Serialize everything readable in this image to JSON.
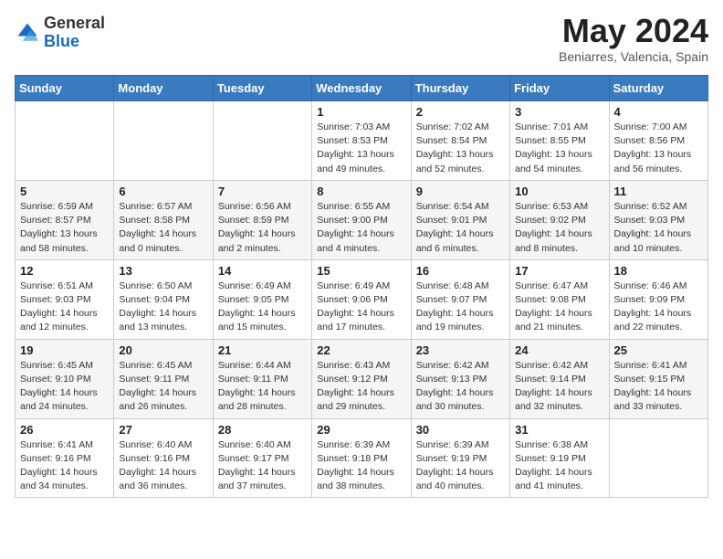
{
  "logo": {
    "general": "General",
    "blue": "Blue"
  },
  "header": {
    "month": "May 2024",
    "location": "Beniarres, Valencia, Spain"
  },
  "weekdays": [
    "Sunday",
    "Monday",
    "Tuesday",
    "Wednesday",
    "Thursday",
    "Friday",
    "Saturday"
  ],
  "weeks": [
    [
      {
        "day": "",
        "info": ""
      },
      {
        "day": "",
        "info": ""
      },
      {
        "day": "",
        "info": ""
      },
      {
        "day": "1",
        "info": "Sunrise: 7:03 AM\nSunset: 8:53 PM\nDaylight: 13 hours\nand 49 minutes."
      },
      {
        "day": "2",
        "info": "Sunrise: 7:02 AM\nSunset: 8:54 PM\nDaylight: 13 hours\nand 52 minutes."
      },
      {
        "day": "3",
        "info": "Sunrise: 7:01 AM\nSunset: 8:55 PM\nDaylight: 13 hours\nand 54 minutes."
      },
      {
        "day": "4",
        "info": "Sunrise: 7:00 AM\nSunset: 8:56 PM\nDaylight: 13 hours\nand 56 minutes."
      }
    ],
    [
      {
        "day": "5",
        "info": "Sunrise: 6:59 AM\nSunset: 8:57 PM\nDaylight: 13 hours\nand 58 minutes."
      },
      {
        "day": "6",
        "info": "Sunrise: 6:57 AM\nSunset: 8:58 PM\nDaylight: 14 hours\nand 0 minutes."
      },
      {
        "day": "7",
        "info": "Sunrise: 6:56 AM\nSunset: 8:59 PM\nDaylight: 14 hours\nand 2 minutes."
      },
      {
        "day": "8",
        "info": "Sunrise: 6:55 AM\nSunset: 9:00 PM\nDaylight: 14 hours\nand 4 minutes."
      },
      {
        "day": "9",
        "info": "Sunrise: 6:54 AM\nSunset: 9:01 PM\nDaylight: 14 hours\nand 6 minutes."
      },
      {
        "day": "10",
        "info": "Sunrise: 6:53 AM\nSunset: 9:02 PM\nDaylight: 14 hours\nand 8 minutes."
      },
      {
        "day": "11",
        "info": "Sunrise: 6:52 AM\nSunset: 9:03 PM\nDaylight: 14 hours\nand 10 minutes."
      }
    ],
    [
      {
        "day": "12",
        "info": "Sunrise: 6:51 AM\nSunset: 9:03 PM\nDaylight: 14 hours\nand 12 minutes."
      },
      {
        "day": "13",
        "info": "Sunrise: 6:50 AM\nSunset: 9:04 PM\nDaylight: 14 hours\nand 13 minutes."
      },
      {
        "day": "14",
        "info": "Sunrise: 6:49 AM\nSunset: 9:05 PM\nDaylight: 14 hours\nand 15 minutes."
      },
      {
        "day": "15",
        "info": "Sunrise: 6:49 AM\nSunset: 9:06 PM\nDaylight: 14 hours\nand 17 minutes."
      },
      {
        "day": "16",
        "info": "Sunrise: 6:48 AM\nSunset: 9:07 PM\nDaylight: 14 hours\nand 19 minutes."
      },
      {
        "day": "17",
        "info": "Sunrise: 6:47 AM\nSunset: 9:08 PM\nDaylight: 14 hours\nand 21 minutes."
      },
      {
        "day": "18",
        "info": "Sunrise: 6:46 AM\nSunset: 9:09 PM\nDaylight: 14 hours\nand 22 minutes."
      }
    ],
    [
      {
        "day": "19",
        "info": "Sunrise: 6:45 AM\nSunset: 9:10 PM\nDaylight: 14 hours\nand 24 minutes."
      },
      {
        "day": "20",
        "info": "Sunrise: 6:45 AM\nSunset: 9:11 PM\nDaylight: 14 hours\nand 26 minutes."
      },
      {
        "day": "21",
        "info": "Sunrise: 6:44 AM\nSunset: 9:11 PM\nDaylight: 14 hours\nand 28 minutes."
      },
      {
        "day": "22",
        "info": "Sunrise: 6:43 AM\nSunset: 9:12 PM\nDaylight: 14 hours\nand 29 minutes."
      },
      {
        "day": "23",
        "info": "Sunrise: 6:42 AM\nSunset: 9:13 PM\nDaylight: 14 hours\nand 30 minutes."
      },
      {
        "day": "24",
        "info": "Sunrise: 6:42 AM\nSunset: 9:14 PM\nDaylight: 14 hours\nand 32 minutes."
      },
      {
        "day": "25",
        "info": "Sunrise: 6:41 AM\nSunset: 9:15 PM\nDaylight: 14 hours\nand 33 minutes."
      }
    ],
    [
      {
        "day": "26",
        "info": "Sunrise: 6:41 AM\nSunset: 9:16 PM\nDaylight: 14 hours\nand 34 minutes."
      },
      {
        "day": "27",
        "info": "Sunrise: 6:40 AM\nSunset: 9:16 PM\nDaylight: 14 hours\nand 36 minutes."
      },
      {
        "day": "28",
        "info": "Sunrise: 6:40 AM\nSunset: 9:17 PM\nDaylight: 14 hours\nand 37 minutes."
      },
      {
        "day": "29",
        "info": "Sunrise: 6:39 AM\nSunset: 9:18 PM\nDaylight: 14 hours\nand 38 minutes."
      },
      {
        "day": "30",
        "info": "Sunrise: 6:39 AM\nSunset: 9:19 PM\nDaylight: 14 hours\nand 40 minutes."
      },
      {
        "day": "31",
        "info": "Sunrise: 6:38 AM\nSunset: 9:19 PM\nDaylight: 14 hours\nand 41 minutes."
      },
      {
        "day": "",
        "info": ""
      }
    ]
  ]
}
